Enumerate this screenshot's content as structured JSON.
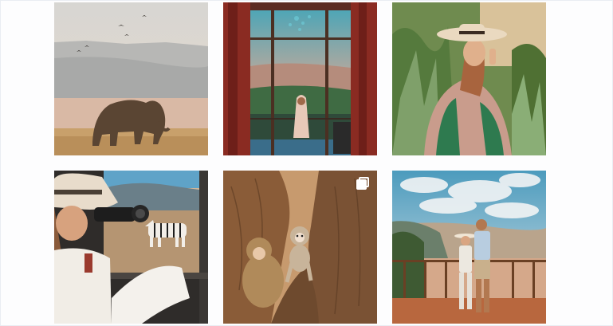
{
  "gallery": {
    "posts": [
      {
        "alt": "",
        "scene": "elephant-savanna"
      },
      {
        "alt": "",
        "scene": "woman-balcony-view"
      },
      {
        "alt": "",
        "scene": "woman-hat-jungle"
      },
      {
        "alt": "",
        "scene": "photographer-zebra"
      },
      {
        "alt": "",
        "scene": "baby-monkeys-tree",
        "badge": "multiple-photos-icon"
      },
      {
        "alt": "",
        "scene": "couple-overlook"
      }
    ]
  },
  "colors": {
    "page_background": "#fdfdfe",
    "badge": "#ffffff"
  }
}
